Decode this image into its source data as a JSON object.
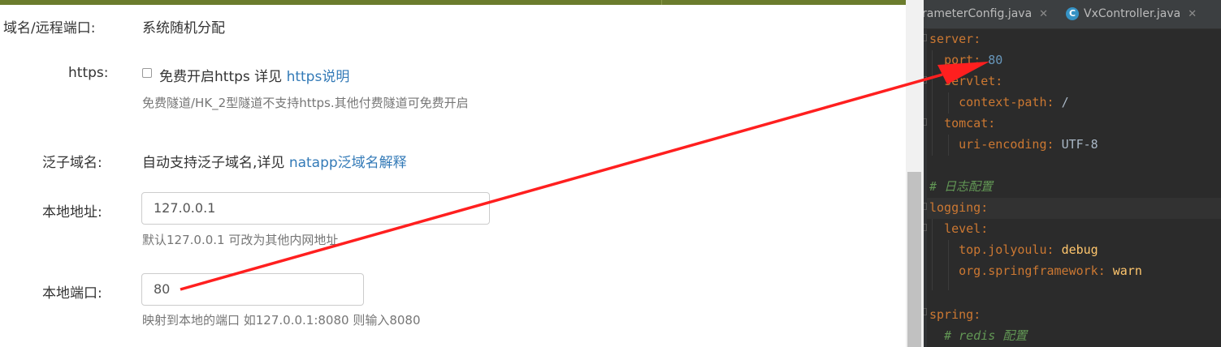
{
  "form": {
    "domain_label": "域名/远程端口:",
    "domain_value": "系统随机分配",
    "https_label": "https:",
    "https_checkbox_text": "免费开启https 详见",
    "https_link": "https说明",
    "https_help": "免费隧道/HK_2型隧道不支持https.其他付费隧道可免费开启",
    "wildcard_label": "泛子域名:",
    "wildcard_text": "自动支持泛子域名,详见",
    "wildcard_link": "natapp泛域名解释",
    "local_addr_label": "本地地址:",
    "local_addr_value": "127.0.0.1",
    "local_addr_help": "默认127.0.0.1 可改为其他内网地址",
    "local_port_label": "本地端口:",
    "local_port_value": "80",
    "local_port_help": "映射到本地的端口 如127.0.0.1:8080 则输入8080"
  },
  "ide": {
    "tabs": [
      {
        "label": "rameterConfig.java",
        "close": "✕"
      },
      {
        "label": "VxController.java",
        "icon": "C",
        "close": "✕"
      }
    ],
    "lines": {
      "server_key": "server",
      "port_key": "port",
      "port_value": "80",
      "servlet_key": "servlet",
      "context_path_key": "context-path",
      "context_path_value": "/",
      "tomcat_key": "tomcat",
      "uri_encoding_key": "uri-encoding",
      "uri_encoding_value": "UTF-8",
      "log_comment": "# 日志配置",
      "logging_key": "logging",
      "level_key": "level",
      "jolyoulu_key": "top.jolyoulu",
      "jolyoulu_value": "debug",
      "springframework_key": "org.springframework",
      "springframework_value": "warn",
      "spring_key": "spring",
      "redis_comment": "# redis 配置",
      "colon": ":"
    }
  },
  "colors": {
    "top_bar": "#6b7c2d",
    "link": "#337ab7",
    "arrow": "#ff1f1f",
    "ide_bg": "#2b2b2b",
    "yaml_key": "#cc7832",
    "yaml_number": "#6897bb"
  },
  "icons": {
    "checkbox": "unchecked-checkbox",
    "tab_close": "close-icon",
    "java_class": "class-c-icon",
    "arrow": "red-arrow"
  }
}
